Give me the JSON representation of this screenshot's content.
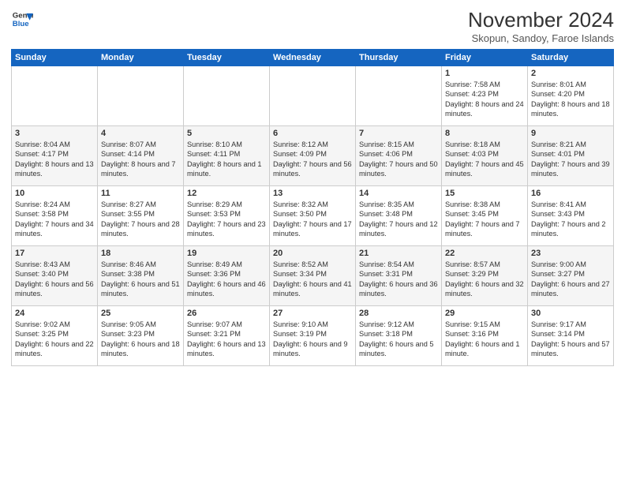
{
  "logo": {
    "line1": "General",
    "line2": "Blue"
  },
  "title": "November 2024",
  "subtitle": "Skopun, Sandoy, Faroe Islands",
  "days_of_week": [
    "Sunday",
    "Monday",
    "Tuesday",
    "Wednesday",
    "Thursday",
    "Friday",
    "Saturday"
  ],
  "weeks": [
    [
      {
        "day": "",
        "data": ""
      },
      {
        "day": "",
        "data": ""
      },
      {
        "day": "",
        "data": ""
      },
      {
        "day": "",
        "data": ""
      },
      {
        "day": "",
        "data": ""
      },
      {
        "day": "1",
        "data": "Sunrise: 7:58 AM\nSunset: 4:23 PM\nDaylight: 8 hours and 24 minutes."
      },
      {
        "day": "2",
        "data": "Sunrise: 8:01 AM\nSunset: 4:20 PM\nDaylight: 8 hours and 18 minutes."
      }
    ],
    [
      {
        "day": "3",
        "data": "Sunrise: 8:04 AM\nSunset: 4:17 PM\nDaylight: 8 hours and 13 minutes."
      },
      {
        "day": "4",
        "data": "Sunrise: 8:07 AM\nSunset: 4:14 PM\nDaylight: 8 hours and 7 minutes."
      },
      {
        "day": "5",
        "data": "Sunrise: 8:10 AM\nSunset: 4:11 PM\nDaylight: 8 hours and 1 minute."
      },
      {
        "day": "6",
        "data": "Sunrise: 8:12 AM\nSunset: 4:09 PM\nDaylight: 7 hours and 56 minutes."
      },
      {
        "day": "7",
        "data": "Sunrise: 8:15 AM\nSunset: 4:06 PM\nDaylight: 7 hours and 50 minutes."
      },
      {
        "day": "8",
        "data": "Sunrise: 8:18 AM\nSunset: 4:03 PM\nDaylight: 7 hours and 45 minutes."
      },
      {
        "day": "9",
        "data": "Sunrise: 8:21 AM\nSunset: 4:01 PM\nDaylight: 7 hours and 39 minutes."
      }
    ],
    [
      {
        "day": "10",
        "data": "Sunrise: 8:24 AM\nSunset: 3:58 PM\nDaylight: 7 hours and 34 minutes."
      },
      {
        "day": "11",
        "data": "Sunrise: 8:27 AM\nSunset: 3:55 PM\nDaylight: 7 hours and 28 minutes."
      },
      {
        "day": "12",
        "data": "Sunrise: 8:29 AM\nSunset: 3:53 PM\nDaylight: 7 hours and 23 minutes."
      },
      {
        "day": "13",
        "data": "Sunrise: 8:32 AM\nSunset: 3:50 PM\nDaylight: 7 hours and 17 minutes."
      },
      {
        "day": "14",
        "data": "Sunrise: 8:35 AM\nSunset: 3:48 PM\nDaylight: 7 hours and 12 minutes."
      },
      {
        "day": "15",
        "data": "Sunrise: 8:38 AM\nSunset: 3:45 PM\nDaylight: 7 hours and 7 minutes."
      },
      {
        "day": "16",
        "data": "Sunrise: 8:41 AM\nSunset: 3:43 PM\nDaylight: 7 hours and 2 minutes."
      }
    ],
    [
      {
        "day": "17",
        "data": "Sunrise: 8:43 AM\nSunset: 3:40 PM\nDaylight: 6 hours and 56 minutes."
      },
      {
        "day": "18",
        "data": "Sunrise: 8:46 AM\nSunset: 3:38 PM\nDaylight: 6 hours and 51 minutes."
      },
      {
        "day": "19",
        "data": "Sunrise: 8:49 AM\nSunset: 3:36 PM\nDaylight: 6 hours and 46 minutes."
      },
      {
        "day": "20",
        "data": "Sunrise: 8:52 AM\nSunset: 3:34 PM\nDaylight: 6 hours and 41 minutes."
      },
      {
        "day": "21",
        "data": "Sunrise: 8:54 AM\nSunset: 3:31 PM\nDaylight: 6 hours and 36 minutes."
      },
      {
        "day": "22",
        "data": "Sunrise: 8:57 AM\nSunset: 3:29 PM\nDaylight: 6 hours and 32 minutes."
      },
      {
        "day": "23",
        "data": "Sunrise: 9:00 AM\nSunset: 3:27 PM\nDaylight: 6 hours and 27 minutes."
      }
    ],
    [
      {
        "day": "24",
        "data": "Sunrise: 9:02 AM\nSunset: 3:25 PM\nDaylight: 6 hours and 22 minutes."
      },
      {
        "day": "25",
        "data": "Sunrise: 9:05 AM\nSunset: 3:23 PM\nDaylight: 6 hours and 18 minutes."
      },
      {
        "day": "26",
        "data": "Sunrise: 9:07 AM\nSunset: 3:21 PM\nDaylight: 6 hours and 13 minutes."
      },
      {
        "day": "27",
        "data": "Sunrise: 9:10 AM\nSunset: 3:19 PM\nDaylight: 6 hours and 9 minutes."
      },
      {
        "day": "28",
        "data": "Sunrise: 9:12 AM\nSunset: 3:18 PM\nDaylight: 6 hours and 5 minutes."
      },
      {
        "day": "29",
        "data": "Sunrise: 9:15 AM\nSunset: 3:16 PM\nDaylight: 6 hours and 1 minute."
      },
      {
        "day": "30",
        "data": "Sunrise: 9:17 AM\nSunset: 3:14 PM\nDaylight: 5 hours and 57 minutes."
      }
    ]
  ]
}
